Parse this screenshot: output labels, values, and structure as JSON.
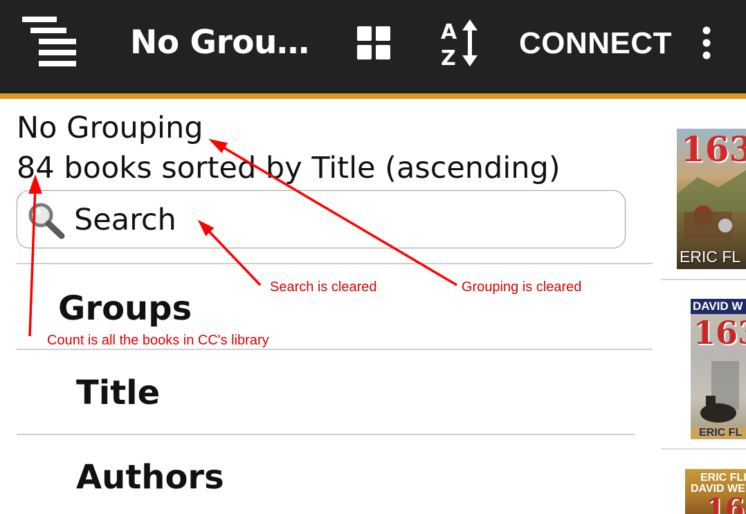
{
  "app_bar": {
    "title": "No Grou…",
    "connect_label": "CONNECT",
    "icons": [
      "menu-icon",
      "grid-view-icon",
      "sort-az-icon",
      "overflow-menu-icon"
    ],
    "background": "#222222",
    "accent": "#d99a1f"
  },
  "header": {
    "grouping": "No Grouping",
    "count": "84 books sorted by Title (ascending)"
  },
  "search": {
    "placeholder": "Search",
    "value": ""
  },
  "groups": {
    "header": "Groups",
    "items": [
      {
        "label": "Title"
      },
      {
        "label": "Authors"
      }
    ]
  },
  "covers": [
    {
      "text": "163",
      "footer": "ERIC FL"
    },
    {
      "top": "DAVID W",
      "text": "163",
      "footer": "ERIC FL"
    },
    {
      "top": "ERIC FLI",
      "top2": "DAVID WE",
      "text": "163"
    }
  ],
  "annotations": {
    "search": "Search is cleared",
    "grouping": "Grouping is cleared",
    "count": "Count is all the books in CC's library",
    "color": "#e00000"
  }
}
